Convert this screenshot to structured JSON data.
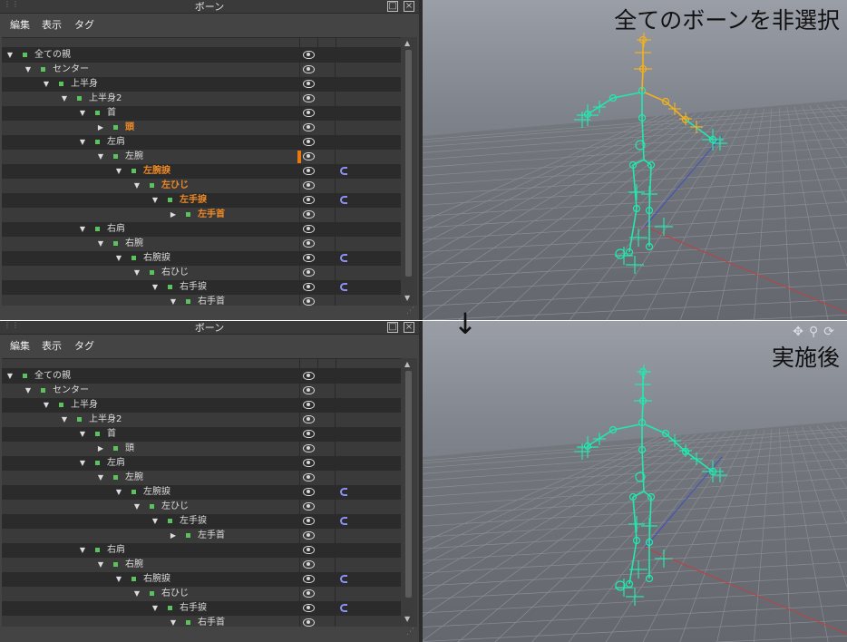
{
  "panel_title": "ボーン",
  "menu": [
    "編集",
    "表示",
    "タグ"
  ],
  "arrow_glyph": "↓",
  "viewport_tools": [
    "move",
    "zoom",
    "rotate"
  ],
  "colors": {
    "bone_cyan": "#22e8b0",
    "bone_selected": "#f0b020",
    "selected_text": "#f08a25",
    "bone_square": "#5dc25d",
    "ik_icon": "#8a8ff2",
    "grid": "#8a8d93",
    "axis_red": "#c04040",
    "axis_blue": "#4050c0"
  },
  "panels": [
    {
      "id": "before",
      "viewport_caption": "全てのボーンを非選択",
      "rows": [
        {
          "label": "全ての親",
          "selected": false,
          "expander": "open",
          "ik": false
        },
        {
          "label": "センター",
          "selected": false,
          "expander": "open",
          "ik": false
        },
        {
          "label": "上半身",
          "selected": false,
          "expander": "open",
          "ik": false
        },
        {
          "label": "上半身2",
          "selected": false,
          "expander": "open",
          "ik": false
        },
        {
          "label": "首",
          "selected": false,
          "expander": "open",
          "ik": false
        },
        {
          "label": "頭",
          "selected": true,
          "expander": "closed",
          "ik": false
        },
        {
          "label": "左肩",
          "selected": false,
          "expander": "open",
          "ik": false
        },
        {
          "label": "左腕",
          "selected": false,
          "expander": "open",
          "ik": false,
          "marker": true
        },
        {
          "label": "左腕捩",
          "selected": true,
          "expander": "open",
          "ik": true
        },
        {
          "label": "左ひじ",
          "selected": true,
          "expander": "open",
          "ik": false
        },
        {
          "label": "左手捩",
          "selected": true,
          "expander": "open",
          "ik": true
        },
        {
          "label": "左手首",
          "selected": true,
          "expander": "closed",
          "ik": false
        },
        {
          "label": "右肩",
          "selected": false,
          "expander": "open",
          "ik": false
        },
        {
          "label": "右腕",
          "selected": false,
          "expander": "open",
          "ik": false
        },
        {
          "label": "右腕捩",
          "selected": false,
          "expander": "open",
          "ik": true
        },
        {
          "label": "右ひじ",
          "selected": false,
          "expander": "open",
          "ik": false
        },
        {
          "label": "右手捩",
          "selected": false,
          "expander": "open",
          "ik": true
        },
        {
          "label": "右手首",
          "selected": false,
          "expander": "open",
          "ik": false
        }
      ]
    },
    {
      "id": "after",
      "viewport_caption": "実施後",
      "rows": [
        {
          "label": "全ての親",
          "selected": false,
          "expander": "open",
          "ik": false
        },
        {
          "label": "センター",
          "selected": false,
          "expander": "open",
          "ik": false
        },
        {
          "label": "上半身",
          "selected": false,
          "expander": "open",
          "ik": false
        },
        {
          "label": "上半身2",
          "selected": false,
          "expander": "open",
          "ik": false
        },
        {
          "label": "首",
          "selected": false,
          "expander": "open",
          "ik": false
        },
        {
          "label": "頭",
          "selected": false,
          "expander": "closed",
          "ik": false
        },
        {
          "label": "左肩",
          "selected": false,
          "expander": "open",
          "ik": false
        },
        {
          "label": "左腕",
          "selected": false,
          "expander": "open",
          "ik": false
        },
        {
          "label": "左腕捩",
          "selected": false,
          "expander": "open",
          "ik": true
        },
        {
          "label": "左ひじ",
          "selected": false,
          "expander": "open",
          "ik": false
        },
        {
          "label": "左手捩",
          "selected": false,
          "expander": "open",
          "ik": true
        },
        {
          "label": "左手首",
          "selected": false,
          "expander": "closed",
          "ik": false
        },
        {
          "label": "右肩",
          "selected": false,
          "expander": "open",
          "ik": false
        },
        {
          "label": "右腕",
          "selected": false,
          "expander": "open",
          "ik": false
        },
        {
          "label": "右腕捩",
          "selected": false,
          "expander": "open",
          "ik": true
        },
        {
          "label": "右ひじ",
          "selected": false,
          "expander": "open",
          "ik": false
        },
        {
          "label": "右手捩",
          "selected": false,
          "expander": "open",
          "ik": true
        },
        {
          "label": "右手首",
          "selected": false,
          "expander": "open",
          "ik": false
        }
      ]
    }
  ]
}
